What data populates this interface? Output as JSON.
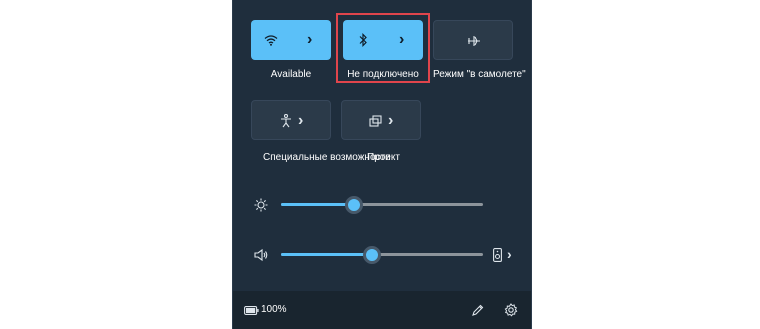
{
  "tiles": [
    {
      "label": "Available",
      "state": "on",
      "icon": "wifi-icon"
    },
    {
      "label": "Не подключено",
      "state": "on",
      "icon": "bluetooth-icon",
      "highlighted": true
    },
    {
      "label": "Режим \"в самолете\"",
      "state": "off",
      "icon": "airplane-icon"
    },
    {
      "label": "Специальные возможности",
      "state": "off",
      "icon": "accessibility-icon"
    },
    {
      "label": "Проект",
      "state": "off",
      "icon": "project-icon"
    }
  ],
  "brightness": {
    "icon": "brightness-icon",
    "level": 0.36
  },
  "volume": {
    "icon": "speaker-icon",
    "level": 0.45,
    "device_icon": "audio-device-icon"
  },
  "footer": {
    "battery_text": "100%",
    "battery_icon": "battery-icon",
    "edit_icon": "pencil-icon",
    "settings_icon": "gear-icon"
  },
  "colors": {
    "panel": "#1f2e3d",
    "accent": "#5bc0f8",
    "tile_off": "#2b3a49",
    "highlight": "#e0454c"
  }
}
